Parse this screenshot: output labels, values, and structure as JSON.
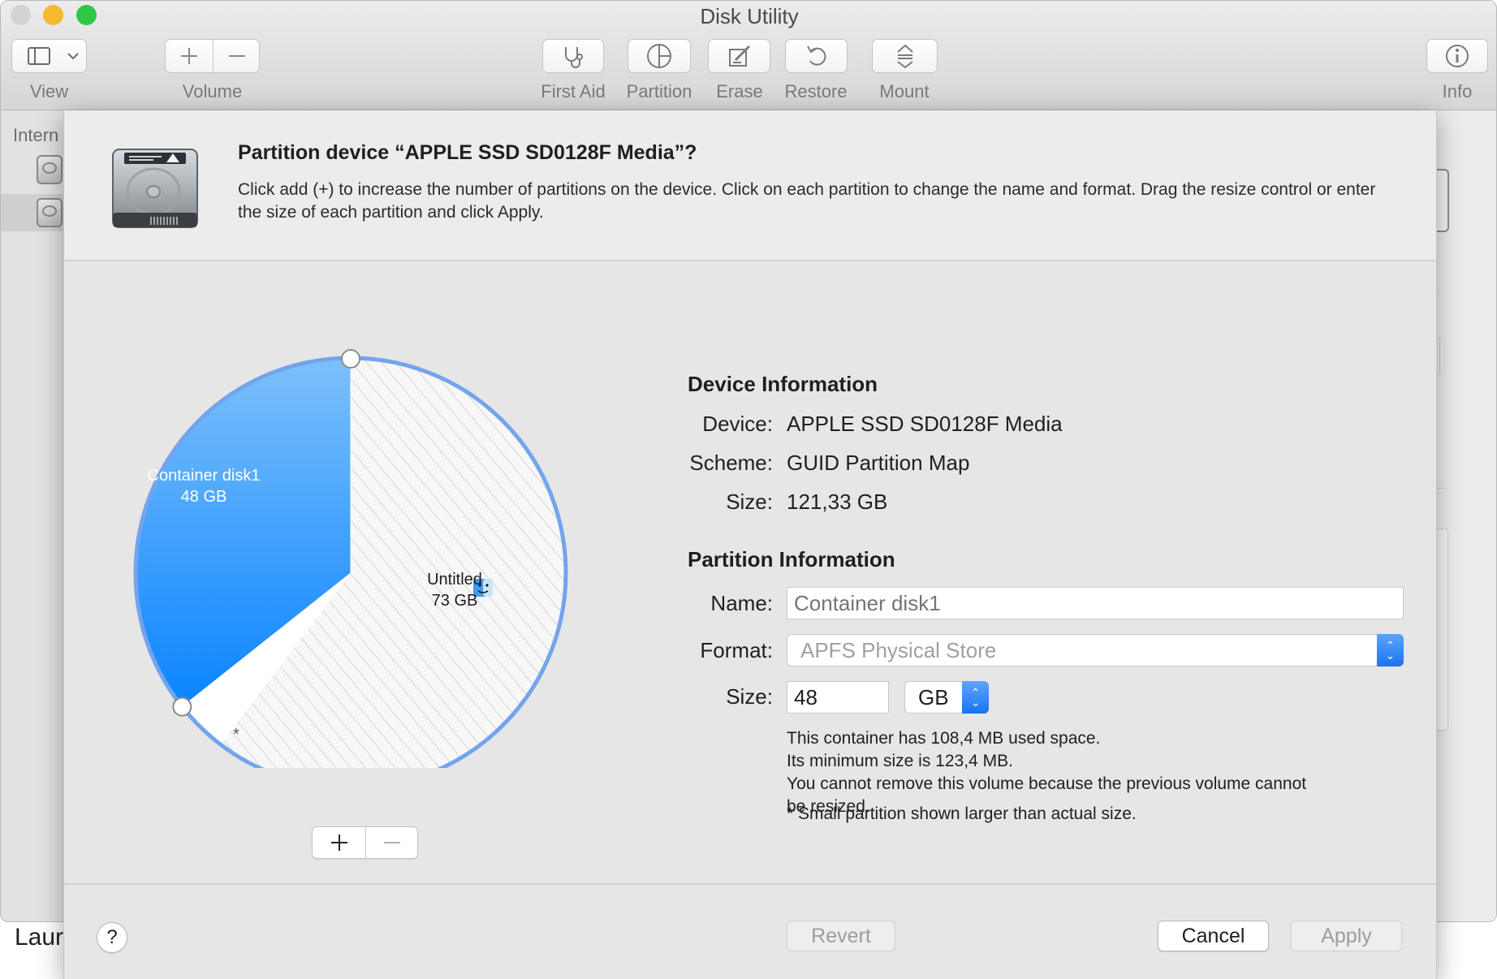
{
  "window": {
    "title": "Disk Utility",
    "traffic_lights": {
      "close": "#d3d3d3",
      "minimize": "#f7b92f",
      "zoom": "#2fc845"
    }
  },
  "toolbar": {
    "view_label": "View",
    "volume_label": "Volume",
    "first_aid_label": "First Aid",
    "partition_label": "Partition",
    "erase_label": "Erase",
    "restore_label": "Restore",
    "mount_label": "Mount",
    "info_label": "Info"
  },
  "sidebar": {
    "header": "Intern",
    "items": [
      {
        "icon": "internal-disk-icon"
      },
      {
        "icon": "internal-disk-icon",
        "selected": true
      }
    ],
    "bottom_text": "Laur"
  },
  "sheet": {
    "title": "Partition device “APPLE SSD SD0128F Media”?",
    "description": "Click add (+) to increase the number of partitions on the device. Click on each partition to change the name and format. Drag the resize control or enter the size of each partition and click Apply.",
    "pie": {
      "accent_color": "#2f94f5",
      "partitions": [
        {
          "name": "Container disk1",
          "size": "48 GB",
          "size_gb": 48
        },
        {
          "name": "Untitled",
          "size": "73 GB",
          "size_gb": 73
        }
      ],
      "small_marker": "*"
    },
    "device_info": {
      "title": "Device Information",
      "device_label": "Device:",
      "device_value": "APPLE SSD SD0128F Media",
      "scheme_label": "Scheme:",
      "scheme_value": "GUID Partition Map",
      "size_label": "Size:",
      "size_value": "121,33 GB"
    },
    "partition_info": {
      "title": "Partition Information",
      "name_label": "Name:",
      "name_placeholder": "Container disk1",
      "format_label": "Format:",
      "format_value": "APFS Physical Store",
      "size_label": "Size:",
      "size_value": "48",
      "size_unit": "GB",
      "note_lines": [
        "This container has 108,4 MB used space.",
        "Its minimum size is 123,4 MB.",
        "You cannot remove this volume because the previous volume cannot",
        "be resized."
      ],
      "footnote": "* Small partition shown larger than actual size."
    },
    "buttons": {
      "help": "?",
      "revert": "Revert",
      "cancel": "Cancel",
      "apply": "Apply"
    }
  }
}
